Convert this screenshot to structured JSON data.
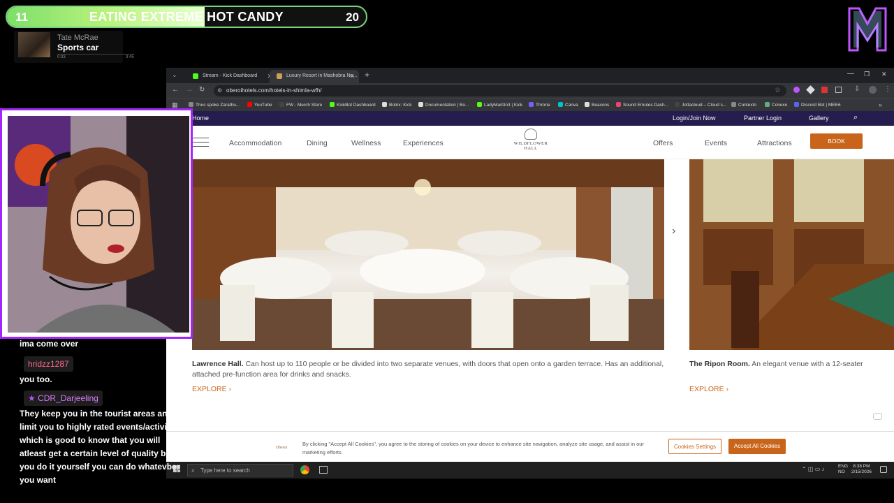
{
  "overlay": {
    "goal": {
      "current": "11",
      "title": "EATING EXTREME HOT CANDY",
      "target": "20",
      "progress": 0.55
    },
    "music": {
      "artist": "Tate McRae",
      "song": "Sports car",
      "elapsed": "0:33",
      "duration": "3:45"
    }
  },
  "chat": {
    "messages": [
      {
        "text": "ima come over"
      },
      {
        "user": "hridzz1287",
        "text": "you too."
      },
      {
        "user": "CDR_Darjeeling",
        "text": "They keep you in the tourist areas and limit you to highly rated events/activities, which is good to know that you will atleast get a certain level of quality but if you do it yourself you can do whatevber you want"
      }
    ]
  },
  "browser": {
    "tabs": [
      {
        "label": "Stream - Kick Dashboard",
        "active": false,
        "color": "#53fc18"
      },
      {
        "label": "Luxury Resort In Mashobra Ne...",
        "active": true,
        "color": "#c8a05a"
      }
    ],
    "url": "oberoihotels.com/hotels-in-shimla-wfh/",
    "bookmarks": [
      {
        "label": "Thus spoke Zarathu...",
        "color": "#888"
      },
      {
        "label": "YouTube",
        "color": "#ff0000"
      },
      {
        "label": "FW - Merch Store",
        "color": "#444"
      },
      {
        "label": "KickBot Dashboard",
        "color": "#53fc18"
      },
      {
        "label": "Botrix: Kick",
        "color": "#ddd"
      },
      {
        "label": "Documentation | Bo...",
        "color": "#ddd"
      },
      {
        "label": "LadyMarl3n3 | Kick",
        "color": "#53fc18"
      },
      {
        "label": "Throne",
        "color": "#7b5cff"
      },
      {
        "label": "Canva",
        "color": "#00c4cc"
      },
      {
        "label": "Beacons",
        "color": "#ddd"
      },
      {
        "label": "Sound Emotes Dash...",
        "color": "#e8447a"
      },
      {
        "label": "Jottacloud – Cloud s...",
        "color": "#444"
      },
      {
        "label": "Contexto",
        "color": "#888"
      },
      {
        "label": "Conexo",
        "color": "#6a8"
      },
      {
        "label": "Discord Bot | MEE6",
        "color": "#5865f2"
      }
    ]
  },
  "site": {
    "topnav": {
      "home": "Home",
      "login": "Login/Join Now",
      "partner": "Partner Login",
      "gallery": "Gallery"
    },
    "mainnav": {
      "accommodation": "Accommodation",
      "dining": "Dining",
      "wellness": "Wellness",
      "experiences": "Experiences",
      "offers": "Offers",
      "events": "Events",
      "attractions": "Attractions",
      "book": "BOOK"
    },
    "brand": {
      "line1": "WILDFLOWER",
      "line2": "HALL"
    },
    "venues": [
      {
        "name": "Lawrence Hall.",
        "desc": "Can host up to 110 people or be divided into two separate venues, with doors that open onto a garden terrace. Has an additional, attached pre-function area for drinks and snacks.",
        "cta": "EXPLORE ›"
      },
      {
        "name": "The Ripon Room.",
        "desc": "An elegant venue with a 12-seater",
        "cta": "EXPLORE ›"
      }
    ],
    "cookie": {
      "text": "By clicking \"Accept All Cookies\", you agree to the storing of cookies on your device to enhance site navigation, analyze site usage, and assist in our marketing efforts.",
      "settings": "Cookies Settings",
      "accept": "Accept All Cookies",
      "logo": "Oberoi"
    }
  },
  "taskbar": {
    "search_placeholder": "Type here to search",
    "lang": "ENG",
    "region": "NO",
    "time": "8:38 PM",
    "date": "2/15/2026"
  }
}
